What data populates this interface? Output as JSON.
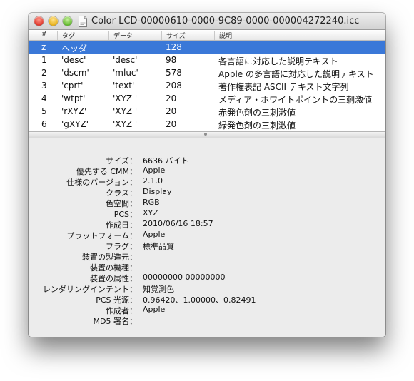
{
  "window": {
    "title": "Color LCD-00000610-0000-9C89-0000-000004272240.icc",
    "icon": "document-icon"
  },
  "columns": [
    "#",
    "タグ",
    "データ",
    "サイズ",
    "説明"
  ],
  "rows": [
    {
      "num": "z",
      "tag": "ヘッダ",
      "data": "",
      "size": "128",
      "desc": "",
      "selected": true
    },
    {
      "num": "1",
      "tag": "'desc'",
      "data": "'desc'",
      "size": "98",
      "desc": "各言語に対応した説明テキスト"
    },
    {
      "num": "2",
      "tag": "'dscm'",
      "data": "'mluc'",
      "size": "578",
      "desc": "Apple の多言語に対応した説明テキスト"
    },
    {
      "num": "3",
      "tag": "'cprt'",
      "data": "'text'",
      "size": "208",
      "desc": "著作権表記 ASCII テキスト文字列"
    },
    {
      "num": "4",
      "tag": "'wtpt'",
      "data": "'XYZ '",
      "size": "20",
      "desc": "メディア・ホワイトポイントの三刺激値"
    },
    {
      "num": "5",
      "tag": "'rXYZ'",
      "data": "'XYZ '",
      "size": "20",
      "desc": "赤発色剤の三刺激値"
    },
    {
      "num": "6",
      "tag": "'gXYZ'",
      "data": "'XYZ '",
      "size": "20",
      "desc": "緑発色剤の三刺激値"
    }
  ],
  "details": [
    {
      "label": "サイズ：",
      "value": "6636 バイト"
    },
    {
      "label": "優先する CMM：",
      "value": "Apple"
    },
    {
      "label": "仕様のバージョン：",
      "value": "2.1.0"
    },
    {
      "label": "クラス：",
      "value": "Display"
    },
    {
      "label": "色空間：",
      "value": "RGB"
    },
    {
      "label": "PCS：",
      "value": "XYZ"
    },
    {
      "label": "作成日：",
      "value": "2010/06/16 18:57"
    },
    {
      "label": "プラットフォーム：",
      "value": "Apple"
    },
    {
      "label": "フラグ：",
      "value": "標準品質"
    },
    {
      "label": "装置の製造元：",
      "value": ""
    },
    {
      "label": "装置の機種：",
      "value": ""
    },
    {
      "label": "装置の属性：",
      "value": "00000000 00000000"
    },
    {
      "label": "レンダリングインテント：",
      "value": "知覚測色"
    },
    {
      "label": "PCS 光源：",
      "value": "0.96420、1.00000、0.82491"
    },
    {
      "label": "作成者：",
      "value": "Apple"
    },
    {
      "label": "MD5 署名：",
      "value": ""
    }
  ],
  "colors": {
    "selection": "#3a78d8",
    "window_bg": "#ececec"
  }
}
